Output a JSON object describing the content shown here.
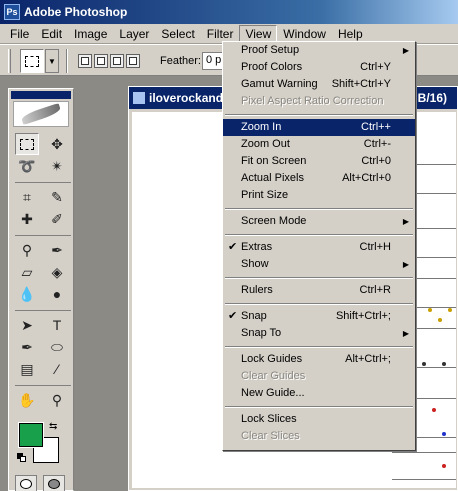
{
  "app": {
    "title": "Adobe Photoshop"
  },
  "menubar": [
    "File",
    "Edit",
    "Image",
    "Layer",
    "Select",
    "Filter",
    "View",
    "Window",
    "Help"
  ],
  "options": {
    "feather_label": "Feather:",
    "feather_value": "0 p"
  },
  "document": {
    "title": "iloverockand",
    "zoom_suffix": "B/16)"
  },
  "view_menu": [
    {
      "label": "Proof Setup",
      "shortcut": "",
      "submenu": true,
      "check": false,
      "disabled": false,
      "highlight": false
    },
    {
      "label": "Proof Colors",
      "shortcut": "Ctrl+Y",
      "submenu": false,
      "check": false,
      "disabled": false,
      "highlight": false
    },
    {
      "label": "Gamut Warning",
      "shortcut": "Shift+Ctrl+Y",
      "submenu": false,
      "check": false,
      "disabled": false,
      "highlight": false
    },
    {
      "label": "Pixel Aspect Ratio Correction",
      "shortcut": "",
      "submenu": false,
      "check": false,
      "disabled": true,
      "highlight": false
    },
    {
      "sep": true
    },
    {
      "label": "Zoom In",
      "shortcut": "Ctrl++",
      "submenu": false,
      "check": false,
      "disabled": false,
      "highlight": true
    },
    {
      "label": "Zoom Out",
      "shortcut": "Ctrl+-",
      "submenu": false,
      "check": false,
      "disabled": false,
      "highlight": false
    },
    {
      "label": "Fit on Screen",
      "shortcut": "Ctrl+0",
      "submenu": false,
      "check": false,
      "disabled": false,
      "highlight": false
    },
    {
      "label": "Actual Pixels",
      "shortcut": "Alt+Ctrl+0",
      "submenu": false,
      "check": false,
      "disabled": false,
      "highlight": false
    },
    {
      "label": "Print Size",
      "shortcut": "",
      "submenu": false,
      "check": false,
      "disabled": false,
      "highlight": false
    },
    {
      "sep": true
    },
    {
      "label": "Screen Mode",
      "shortcut": "",
      "submenu": true,
      "check": false,
      "disabled": false,
      "highlight": false
    },
    {
      "sep": true
    },
    {
      "label": "Extras",
      "shortcut": "Ctrl+H",
      "submenu": false,
      "check": true,
      "disabled": false,
      "highlight": false
    },
    {
      "label": "Show",
      "shortcut": "",
      "submenu": true,
      "check": false,
      "disabled": false,
      "highlight": false
    },
    {
      "sep": true
    },
    {
      "label": "Rulers",
      "shortcut": "Ctrl+R",
      "submenu": false,
      "check": false,
      "disabled": false,
      "highlight": false
    },
    {
      "sep": true
    },
    {
      "label": "Snap",
      "shortcut": "Shift+Ctrl+;",
      "submenu": false,
      "check": true,
      "disabled": false,
      "highlight": false
    },
    {
      "label": "Snap To",
      "shortcut": "",
      "submenu": true,
      "check": false,
      "disabled": false,
      "highlight": false
    },
    {
      "sep": true
    },
    {
      "label": "Lock Guides",
      "shortcut": "Alt+Ctrl+;",
      "submenu": false,
      "check": false,
      "disabled": false,
      "highlight": false
    },
    {
      "label": "Clear Guides",
      "shortcut": "",
      "submenu": false,
      "check": false,
      "disabled": true,
      "highlight": false
    },
    {
      "label": "New Guide...",
      "shortcut": "",
      "submenu": false,
      "check": false,
      "disabled": false,
      "highlight": false
    },
    {
      "sep": true
    },
    {
      "label": "Lock Slices",
      "shortcut": "",
      "submenu": false,
      "check": false,
      "disabled": false,
      "highlight": false
    },
    {
      "label": "Clear Slices",
      "shortcut": "",
      "submenu": false,
      "check": false,
      "disabled": true,
      "highlight": false
    }
  ],
  "toolbox": {
    "tools": [
      "marquee-tool",
      "move-tool",
      "lasso-tool",
      "magic-wand-tool",
      "crop-tool",
      "slice-tool",
      "healing-brush-tool",
      "brush-tool",
      "clone-stamp-tool",
      "history-brush-tool",
      "eraser-tool",
      "paint-bucket-tool",
      "blur-tool",
      "dodge-tool",
      "path-selection-tool",
      "type-tool",
      "pen-tool",
      "shape-tool",
      "notes-tool",
      "eyedropper-tool",
      "hand-tool",
      "zoom-tool"
    ],
    "glyphs": {
      "move-tool": "✥",
      "lasso-tool": "➰",
      "magic-wand-tool": "✴",
      "crop-tool": "⌗",
      "slice-tool": "✎",
      "healing-brush-tool": "✚",
      "brush-tool": "✐",
      "clone-stamp-tool": "⚲",
      "history-brush-tool": "✒",
      "eraser-tool": "▱",
      "paint-bucket-tool": "◈",
      "blur-tool": "💧",
      "dodge-tool": "●",
      "path-selection-tool": "➤",
      "type-tool": "T",
      "pen-tool": "✒",
      "shape-tool": "⬭",
      "notes-tool": "▤",
      "eyedropper-tool": "⁄",
      "hand-tool": "✋",
      "zoom-tool": "⚲"
    },
    "foreground_color": "#18a04a",
    "background_color": "#ffffff"
  },
  "colors": {
    "highlight": "#0a246a",
    "menu_bg": "#d4d0c8",
    "disabled_text": "#8a8780"
  }
}
